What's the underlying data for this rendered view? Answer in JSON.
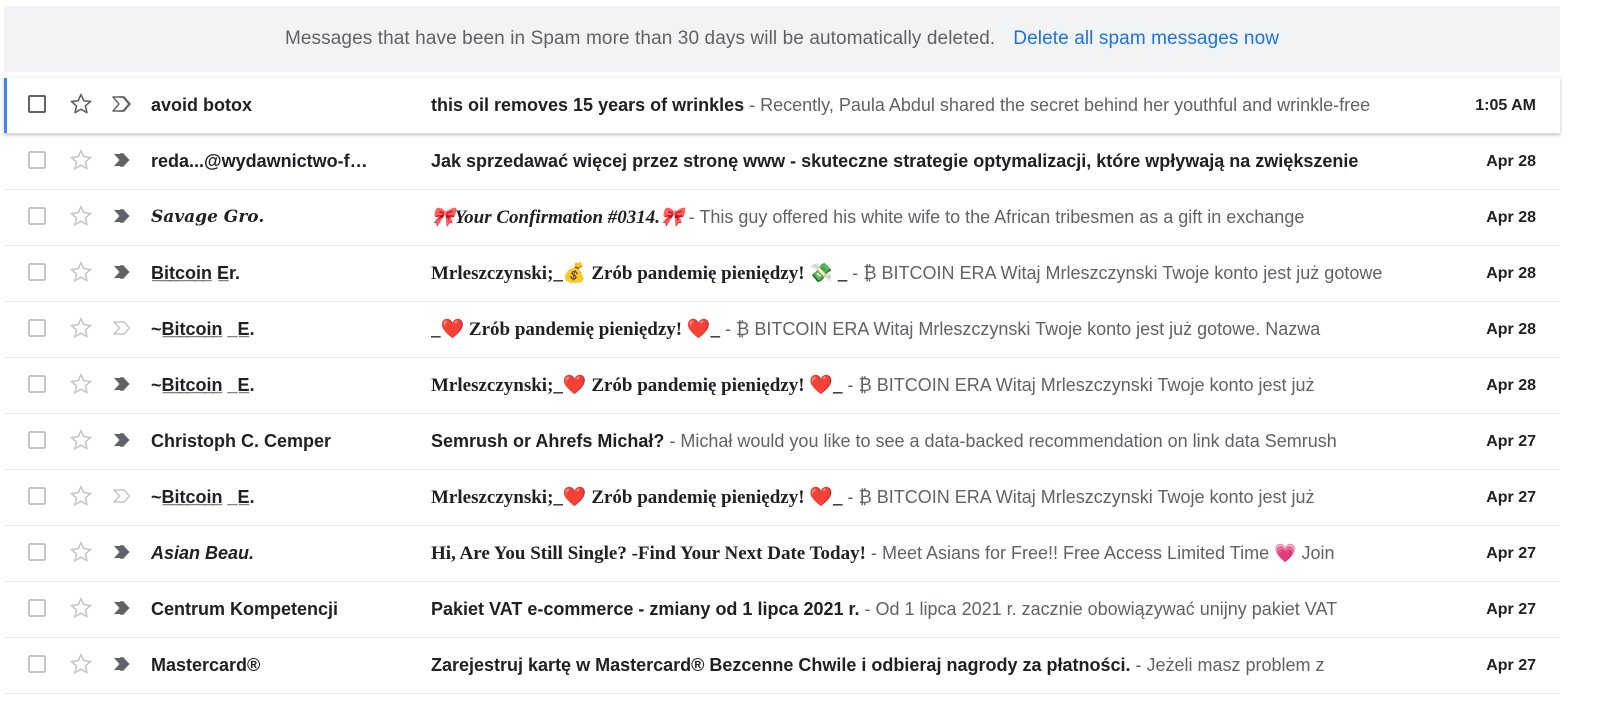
{
  "banner": {
    "notice": "Messages that have been in Spam more than 30 days will be automatically deleted.",
    "action": "Delete all spam messages now"
  },
  "colors": {
    "accent_blue": "#1a73e8",
    "focus_bar": "#4285f4",
    "banner_bg": "#f1f3f4",
    "text_primary": "#202124",
    "text_secondary": "#5f6368"
  },
  "icons": {
    "checkbox": "checkbox-icon",
    "star": "star-outline-icon",
    "important": "important-marker-icon"
  },
  "emails": [
    {
      "sender": "avoid botox",
      "subject": "this oil removes 15 years of wrinkles",
      "snippet": " - Recently, Paula Abdul shared the secret behind her youthful and wrinkle-free",
      "date": "1:05 AM",
      "important": true
    },
    {
      "sender": "reda...@wydawnictwo-f…",
      "subject": "Jak sprzedawać więcej przez stronę www - skuteczne strategie optymalizacji, które wpływają na zwiększenie",
      "snippet": "",
      "date": "Apr 28",
      "important": true
    },
    {
      "sender": "Savage Gro.",
      "subject": "🎀Your Confirmation #0314.🎀",
      "snippet": " - This guy offered his white wife to the African tribesmen as a gift in exchange",
      "date": "Apr 28",
      "important": true
    },
    {
      "sender": "B̲i̲t̲c̲o̲i̲n̲ E̲r.",
      "subject": "Mrleszczynski;_💰 Zrób pandemię pieniędzy! 💸 _",
      "snippet": " - ₿ BITCOIN ERA Witaj Mrleszczynski Twoje konto jest już gotowe",
      "date": "Apr 28",
      "important": true
    },
    {
      "sender": "~B̲i̲t̲c̲o̲i̲n̲ _E̲.",
      "subject": "_❤️ Zrób pandemię pieniędzy! ❤️_",
      "snippet": " - ₿ BITCOIN ERA Witaj Mrleszczynski Twoje konto jest już gotowe. Nazwa",
      "date": "Apr 28",
      "important": false
    },
    {
      "sender": "~B̲i̲t̲c̲o̲i̲n̲ _E̲.",
      "subject": "Mrleszczynski;_❤️ Zrób pandemię pieniędzy! ❤️_",
      "snippet": " - ₿ BITCOIN ERA Witaj Mrleszczynski Twoje konto jest już",
      "date": "Apr 28",
      "important": true
    },
    {
      "sender": "Christoph C. Cemper",
      "subject": "Semrush or Ahrefs Michał?",
      "snippet": " - Michał would you like to see a data-backed recommendation on link data Semrush",
      "date": "Apr 27",
      "important": true
    },
    {
      "sender": "~B̲i̲t̲c̲o̲i̲n̲ _E̲.",
      "subject": "Mrleszczynski;_❤️ Zrób pandemię pieniędzy! ❤️_",
      "snippet": " - ₿ BITCOIN ERA Witaj Mrleszczynski Twoje konto jest już",
      "date": "Apr 27",
      "important": false
    },
    {
      "sender": "Asian Beau.",
      "subject": "Hi, Are You Still Single? -Find Your Next Date Today!",
      "snippet": " - Meet Asians for Free!! Free Access Limited Time 💗 Join",
      "date": "Apr 27",
      "important": true
    },
    {
      "sender": "Centrum Kompetencji",
      "subject": "Pakiet VAT e-commerce - zmiany od 1 lipca 2021 r.",
      "snippet": " - Od 1 lipca 2021 r. zacznie obowiązywać unijny pakiet VAT",
      "date": "Apr 27",
      "important": true
    },
    {
      "sender": "Mastercard®",
      "subject": "Zarejestruj kartę w Mastercard® Bezcenne Chwile i odbieraj nagrody za płatności.",
      "snippet": " - Jeżeli masz problem z",
      "date": "Apr 27",
      "important": true
    }
  ]
}
